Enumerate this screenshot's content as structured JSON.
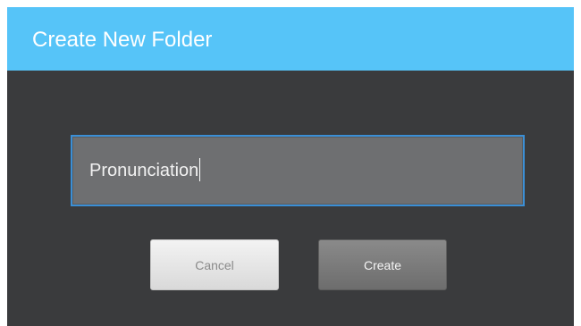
{
  "dialog": {
    "title": "Create New Folder",
    "folder_name": {
      "value": "Pronunciation",
      "placeholder": ""
    },
    "buttons": {
      "cancel_label": "Cancel",
      "create_label": "Create"
    }
  },
  "colors": {
    "title_bar": "#56c4f8",
    "dialog_background": "#3a3b3d",
    "input_background": "#6e6f71",
    "input_focus_border": "#3b8fd6",
    "cancel_button": "#e6e6e6",
    "create_button": "#7b7b7b"
  }
}
